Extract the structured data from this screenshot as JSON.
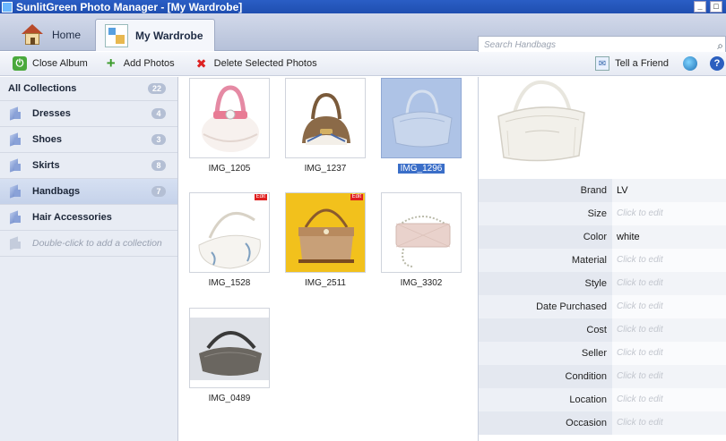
{
  "window": {
    "title": "SunlitGreen Photo Manager - [My Wardrobe]"
  },
  "tabs": [
    {
      "label": "Home",
      "icon": "home-icon"
    },
    {
      "label": "My Wardrobe",
      "icon": "wardrobe-icon"
    }
  ],
  "search": {
    "placeholder": "Search Handbags"
  },
  "toolbar": {
    "close_album": "Close Album",
    "add_photos": "Add Photos",
    "delete_selected": "Delete Selected Photos",
    "tell_friend": "Tell a Friend"
  },
  "sidebar": {
    "all": {
      "label": "All Collections",
      "count": "22"
    },
    "items": [
      {
        "label": "Dresses",
        "count": "4"
      },
      {
        "label": "Shoes",
        "count": "3"
      },
      {
        "label": "Skirts",
        "count": "8"
      },
      {
        "label": "Handbags",
        "count": "7"
      },
      {
        "label": "Hair Accessories",
        "count": ""
      }
    ],
    "add_hint": "Double-click to add a collection",
    "selected": "Handbags"
  },
  "photos": [
    {
      "name": "IMG_1205",
      "edit_badge": "",
      "selected": false
    },
    {
      "name": "IMG_1237",
      "edit_badge": "",
      "selected": false
    },
    {
      "name": "IMG_1296",
      "edit_badge": "",
      "selected": true
    },
    {
      "name": "IMG_1528",
      "edit_badge": "Edit",
      "selected": false
    },
    {
      "name": "IMG_2511",
      "edit_badge": "Edit",
      "selected": false
    },
    {
      "name": "IMG_3302",
      "edit_badge": "",
      "selected": false
    },
    {
      "name": "IMG_0489",
      "edit_badge": "",
      "selected": false
    }
  ],
  "details": {
    "properties": [
      {
        "label": "Brand",
        "value": "LV"
      },
      {
        "label": "Size",
        "value": "Click to edit"
      },
      {
        "label": "Color",
        "value": "white"
      },
      {
        "label": "Material",
        "value": "Click to edit"
      },
      {
        "label": "Style",
        "value": "Click to edit"
      },
      {
        "label": "Date Purchased",
        "value": "Click to edit"
      },
      {
        "label": "Cost",
        "value": "Click to edit"
      },
      {
        "label": "Seller",
        "value": "Click to edit"
      },
      {
        "label": "Condition",
        "value": "Click to edit"
      },
      {
        "label": "Location",
        "value": "Click to edit"
      },
      {
        "label": "Occasion",
        "value": "Click to edit"
      }
    ]
  },
  "colors": {
    "titlebar": "#2a5ec5",
    "selection": "#3a6ec8",
    "sidebar_bg": "#e8ecf4",
    "edit_badge": "#e02020"
  }
}
